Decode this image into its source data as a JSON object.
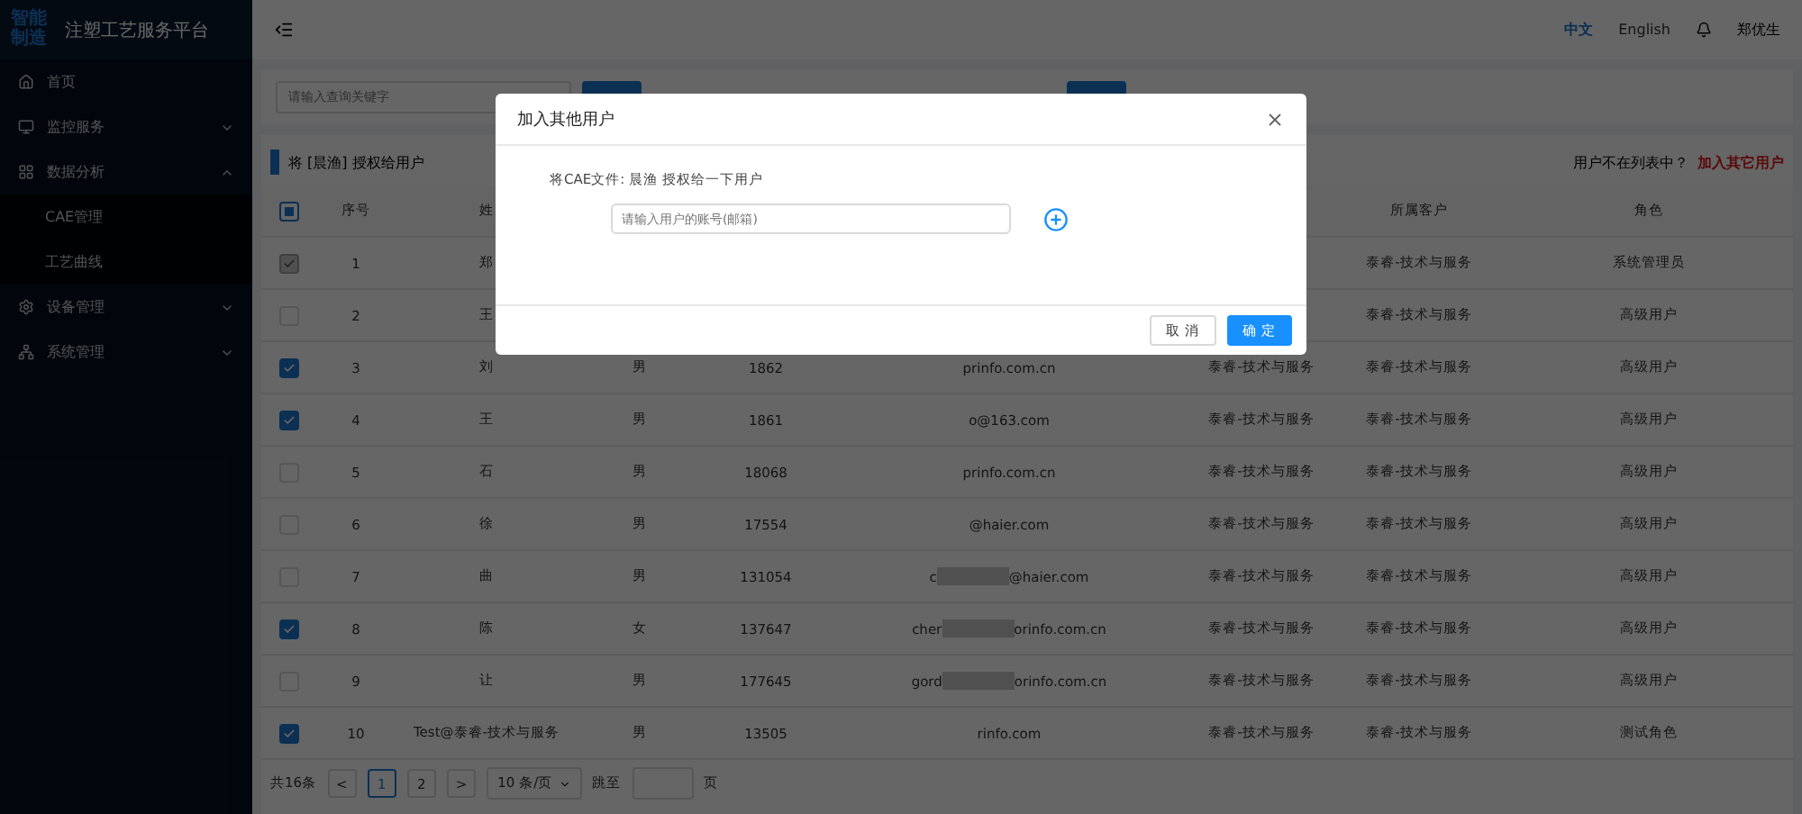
{
  "sidebar": {
    "logo": "智能制造",
    "title": "注塑工艺服务平台",
    "items": [
      {
        "kind": "home",
        "label": "首页"
      },
      {
        "kind": "monitor",
        "label": "监控服务",
        "expanded": false
      },
      {
        "kind": "grid",
        "label": "数据分析",
        "expanded": true,
        "children": [
          {
            "label": "CAE管理"
          },
          {
            "label": "工艺曲线"
          }
        ]
      },
      {
        "kind": "gear",
        "label": "设备管理",
        "expanded": false
      },
      {
        "kind": "network",
        "label": "系统管理",
        "expanded": false
      }
    ]
  },
  "topbar": {
    "languages": [
      {
        "label": "中文",
        "selected": true
      },
      {
        "label": "English",
        "selected": false
      }
    ],
    "user": "郑优生"
  },
  "search": {
    "placeholder": "请输入查询关键字"
  },
  "section": {
    "title": "将 [晨渔] 授权给用户",
    "hint": "用户不在列表中？",
    "link": "加入其它用户"
  },
  "table": {
    "header_checkbox": {
      "indeterminate": true
    },
    "columns": [
      {
        "label": "序号"
      },
      {
        "label": "姓"
      },
      {},
      {},
      {},
      {},
      {
        "label": "所属客户"
      },
      {
        "label": "角色"
      }
    ],
    "rows": [
      {
        "selected": true,
        "disabled": true,
        "cells": [
          "1",
          "郑",
          null,
          null,
          null,
          null,
          "泰睿-技术与服务",
          "系统管理员"
        ]
      },
      {
        "selected": false,
        "disabled": false,
        "cells": [
          "2",
          "王",
          null,
          null,
          null,
          null,
          "泰睿-技术与服务",
          "高级用户"
        ]
      },
      {
        "selected": true,
        "disabled": false,
        "cells": [
          "3",
          "刘",
          "男",
          "1862",
          "prinfo.com.cn",
          "泰睿-技术与服务",
          "泰睿-技术与服务",
          "高级用户"
        ]
      },
      {
        "selected": true,
        "disabled": false,
        "cells": [
          "4",
          "王",
          "男",
          "1861",
          "o@163.com",
          "泰睿-技术与服务",
          "泰睿-技术与服务",
          "高级用户"
        ]
      },
      {
        "selected": false,
        "disabled": false,
        "cells": [
          "5",
          "石",
          "男",
          "18068",
          "prinfo.com.cn",
          "泰睿-技术与服务",
          "泰睿-技术与服务",
          "高级用户"
        ]
      },
      {
        "selected": false,
        "disabled": false,
        "cells": [
          "6",
          "徐",
          "男",
          "17554",
          "@haier.com",
          "泰睿-技术与服务",
          "泰睿-技术与服务",
          "高级用户"
        ]
      },
      {
        "selected": false,
        "disabled": false,
        "cells": [
          "7",
          "曲",
          "男",
          "131054",
          [
            "c",
            "@haier.com"
          ],
          "泰睿-技术与服务",
          "泰睿-技术与服务",
          "高级用户"
        ]
      },
      {
        "selected": true,
        "disabled": false,
        "cells": [
          "8",
          "陈",
          "女",
          "137647",
          [
            "cher",
            "orinfo.com.cn"
          ],
          "泰睿-技术与服务",
          "泰睿-技术与服务",
          "高级用户"
        ]
      },
      {
        "selected": false,
        "disabled": false,
        "cells": [
          "9",
          "让",
          "男",
          "177645",
          [
            "gord",
            "orinfo.com.cn"
          ],
          "泰睿-技术与服务",
          "泰睿-技术与服务",
          "高级用户"
        ]
      },
      {
        "selected": true,
        "disabled": false,
        "cells": [
          "10",
          "Test@泰睿-技术与服务",
          "男",
          "13505",
          "rinfo.com",
          "泰睿-技术与服务",
          "泰睿-技术与服务",
          "测试角色"
        ]
      }
    ]
  },
  "pagination": {
    "total": "共16条",
    "prev": "<",
    "pages": [
      {
        "label": "1",
        "selected": true
      },
      {
        "label": "2",
        "selected": false
      }
    ],
    "next": ">",
    "page_size": "10 条/页",
    "jump_label": "跳至",
    "jump_suffix": "页"
  },
  "dialog": {
    "title": "加入其他用户",
    "message": "将CAE文件: 晨渔 授权给一下用户",
    "placeholder": "请输入用户的账号(邮箱)",
    "buttons": [
      {
        "label": "取 消",
        "kind": "default"
      },
      {
        "label": "确 定",
        "kind": "primary"
      }
    ]
  }
}
